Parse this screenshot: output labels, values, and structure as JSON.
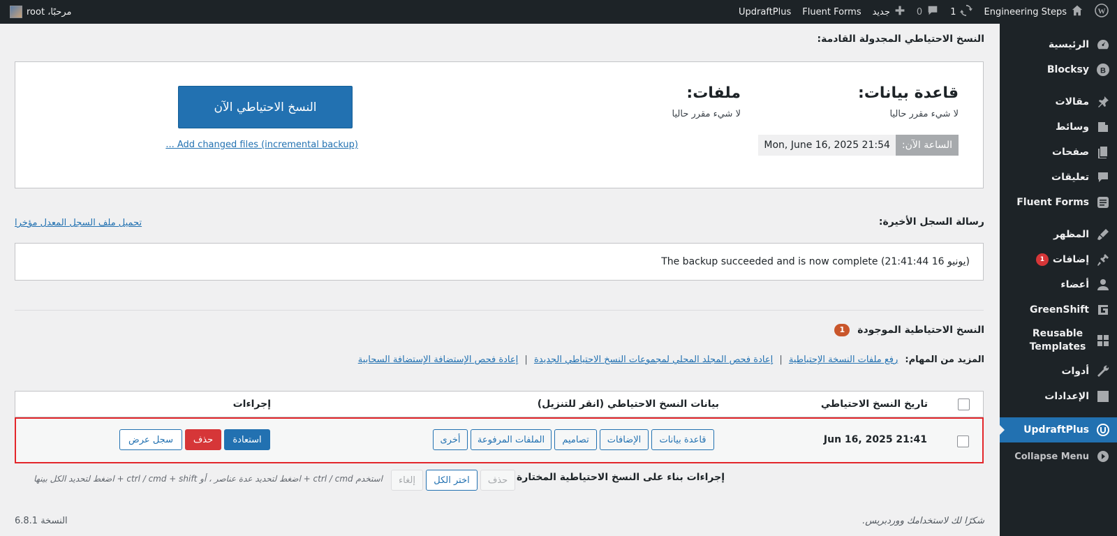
{
  "adminbar": {
    "wp_logo": "wordpress-icon",
    "site_name": "Engineering Steps",
    "updates_count": "1",
    "comments_count": "0",
    "new_label": "جديد",
    "fluent_forms": "Fluent Forms",
    "updraftplus": "UpdraftPlus",
    "greeting": "مرحبًا، root"
  },
  "sidebar": {
    "items": [
      {
        "label": "الرئيسية",
        "icon": "dashboard-icon"
      },
      {
        "label": "Blocksy",
        "icon": "blocksy-icon"
      },
      {
        "label": "مقالات",
        "icon": "pin-icon"
      },
      {
        "label": "وسائط",
        "icon": "media-icon"
      },
      {
        "label": "صفحات",
        "icon": "pages-icon"
      },
      {
        "label": "تعليقات",
        "icon": "comments-icon"
      },
      {
        "label": "Fluent Forms",
        "icon": "fluent-forms-icon"
      },
      {
        "label": "المظهر",
        "icon": "appearance-icon"
      },
      {
        "label": "إضافات",
        "icon": "plugins-icon",
        "badge": "1"
      },
      {
        "label": "أعضاء",
        "icon": "users-icon"
      },
      {
        "label": "GreenShift",
        "icon": "greenshift-icon"
      },
      {
        "label_line1": "Reusable",
        "label_line2": "Templates",
        "icon": "templates-icon"
      },
      {
        "label": "أدوات",
        "icon": "tools-icon"
      },
      {
        "label": "الإعدادات",
        "icon": "settings-icon"
      },
      {
        "label": "UpdraftPlus",
        "icon": "updraftplus-icon"
      },
      {
        "label": "Collapse Menu",
        "icon": "collapse-icon"
      }
    ]
  },
  "scheduled": {
    "title": "النسخ الاحتياطي المجدولة القادمة:",
    "database_heading": "قاعدة بيانات:",
    "database_status": "لا شيء مقرر حاليا",
    "files_heading": "ملفات:",
    "files_status": "لا شيء مقرر حاليا",
    "now_label": "الساعة الآن:",
    "now_value": "Mon, June 16, 2025 21:54",
    "backup_now": "النسخ الاحتياطي الآن",
    "incremental_link": "... Add changed files (incremental backup)"
  },
  "log": {
    "title": "رسالة السجل الأخيرة:",
    "download_link": "تحميل ملف السجل المعدل مؤخرا",
    "message": "The backup succeeded and is now complete (يونيو 16 21:41:44)"
  },
  "existing": {
    "title": "النسخ الاحتياطية الموجودة",
    "count": "1",
    "more_tasks_label": "المزيد من المهام:",
    "task_links": [
      "رفع ملفات النسخة الإحتياطية",
      "إعادة فحص المجلد المحلي لمجموعات النسخ الاحتياطي الجديدة",
      "إعادة فحص الإستضافة الإستضافة السحابية"
    ],
    "separator": "|"
  },
  "table": {
    "col_date": "تاريخ النسخ الاحتياطي",
    "col_data": "بيانات النسخ الاحتياطي (انقر للتنزيل)",
    "col_actions": "إجراءات",
    "rows": [
      {
        "date": "Jun 16, 2025 21:41",
        "components": [
          "قاعدة بيانات",
          "الإضافات",
          "تصاميم",
          "الملفات المرفوعة",
          "أخرى"
        ],
        "restore": "استعادة",
        "delete": "حذف",
        "view_log": "سجل عرض"
      }
    ]
  },
  "bulk": {
    "title": "إجراءات بناء على النسخ الاحتياطية المختارة",
    "delete": "حذف",
    "select_all": "اختر الكل",
    "cancel": "إلغاء",
    "hint": "استخدم ctrl / cmd + اضغط لتحديد عدة عناصر ، أو ctrl / cmd + shift + اضغط لتحديد الكل بينها"
  },
  "footer": {
    "thanks": "شكرًا لك لاستخدامك ووردبريس.",
    "version": "النسخة 6.8.1"
  },
  "colors": {
    "primary": "#2271b1",
    "danger": "#d63638",
    "admin_bg": "#1d2327",
    "highlight_border": "#e3262b"
  }
}
